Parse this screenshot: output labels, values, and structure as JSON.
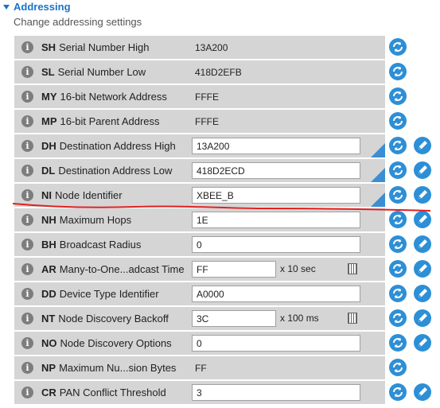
{
  "section": {
    "title": "Addressing",
    "subtitle": "Change addressing settings"
  },
  "colors": {
    "accent": "#2d8fd6",
    "row_bg": "#d5d5d5",
    "annotation": "#e02020"
  },
  "rows": [
    {
      "code": "SH",
      "name": "Serial Number High",
      "value": "13A200",
      "editable": false
    },
    {
      "code": "SL",
      "name": "Serial Number Low",
      "value": "418D2EFB",
      "editable": false
    },
    {
      "code": "MY",
      "name": "16-bit Network Address",
      "value": "FFFE",
      "editable": false
    },
    {
      "code": "MP",
      "name": "16-bit Parent Address",
      "value": "FFFE",
      "editable": false
    },
    {
      "code": "DH",
      "name": "Destination Address High",
      "value": "13A200",
      "editable": true,
      "modified": true
    },
    {
      "code": "DL",
      "name": "Destination Address Low",
      "value": "418D2ECD",
      "editable": true,
      "modified": true
    },
    {
      "code": "NI",
      "name": "Node Identifier",
      "value": "XBEE_B",
      "editable": true,
      "modified": true
    },
    {
      "code": "NH",
      "name": "Maximum Hops",
      "value": "1E",
      "editable": true
    },
    {
      "code": "BH",
      "name": "Broadcast Radius",
      "value": "0",
      "editable": true
    },
    {
      "code": "AR",
      "name": "Many-to-One...adcast Time",
      "value": "FF",
      "editable": true,
      "unit": "x 10 sec",
      "calculator": true
    },
    {
      "code": "DD",
      "name": "Device Type Identifier",
      "value": "A0000",
      "editable": true
    },
    {
      "code": "NT",
      "name": "Node Discovery Backoff",
      "value": "3C",
      "editable": true,
      "unit": "x 100 ms",
      "calculator": true
    },
    {
      "code": "NO",
      "name": "Node Discovery Options",
      "value": "0",
      "editable": true
    },
    {
      "code": "NP",
      "name": "Maximum Nu...sion Bytes",
      "value": "FF",
      "editable": false
    },
    {
      "code": "CR",
      "name": "PAN Conflict Threshold",
      "value": "3",
      "editable": true
    }
  ],
  "icons": {
    "info": "info-icon",
    "read": "refresh-icon",
    "write": "pencil-icon",
    "calc": "calculator-icon"
  },
  "info_glyph": "i"
}
